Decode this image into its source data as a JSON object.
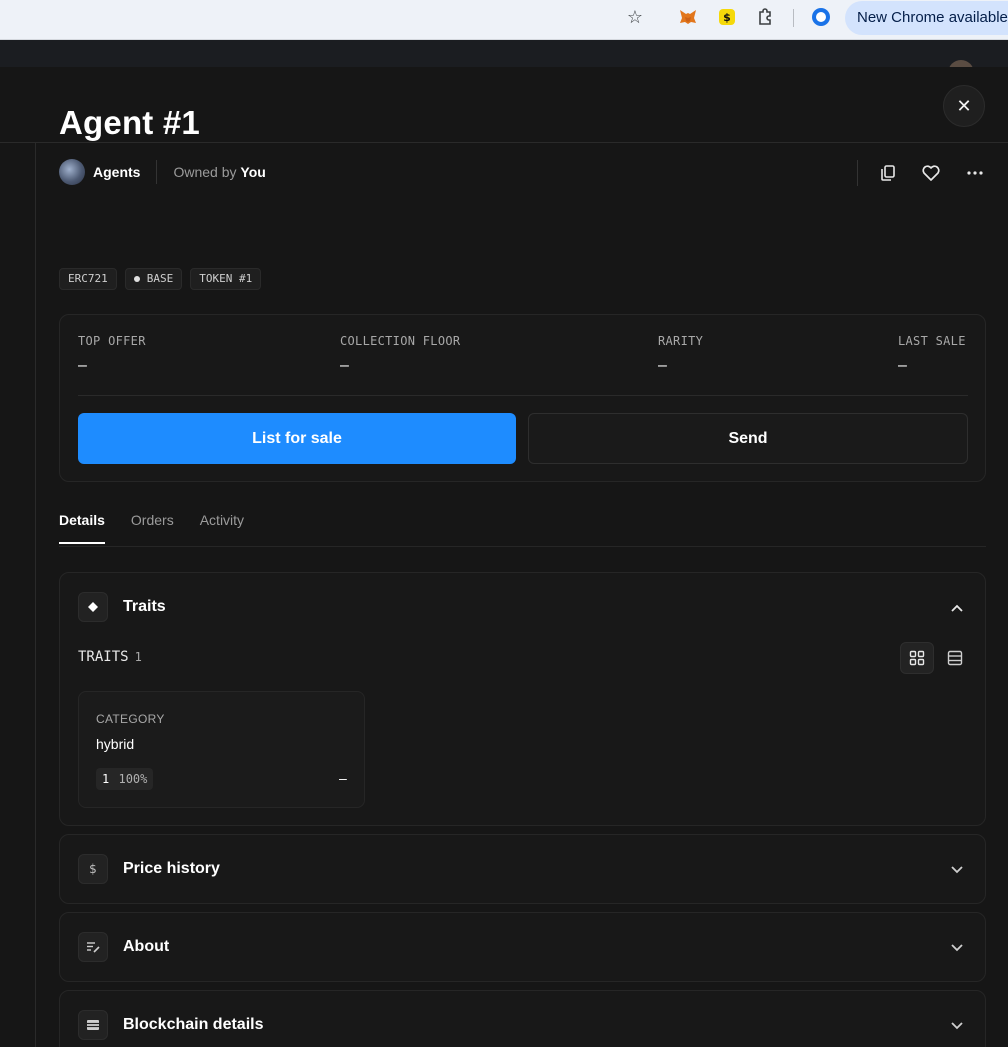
{
  "browser": {
    "update_chip": "New Chrome available",
    "icons": [
      "star-icon",
      "metamask-icon",
      "extension-icon",
      "puzzle-icon",
      "profile-icon"
    ]
  },
  "modal": {
    "close_symbol": "✕"
  },
  "item": {
    "title": "Agent #1",
    "collection": "Agents",
    "owned_prefix": "Owned by",
    "owner": "You",
    "badges": {
      "standard": "ERC721",
      "chain": "BASE",
      "token": "TOKEN #1"
    }
  },
  "stats": {
    "top_offer": {
      "label": "TOP OFFER",
      "value": "–"
    },
    "collection_floor": {
      "label": "COLLECTION FLOOR",
      "value": "–"
    },
    "rarity": {
      "label": "RARITY",
      "value": "–"
    },
    "last_sale": {
      "label": "LAST SALE",
      "value": "–"
    }
  },
  "buttons": {
    "list_for_sale": "List for sale",
    "send": "Send"
  },
  "tabs": [
    {
      "label": "Details",
      "active": true
    },
    {
      "label": "Orders",
      "active": false
    },
    {
      "label": "Activity",
      "active": false
    }
  ],
  "traits_panel": {
    "title": "Traits",
    "section_label": "TRAITS",
    "count": "1",
    "trait": {
      "type": "CATEGORY",
      "value": "hybrid",
      "count": "1",
      "percent": "100%",
      "price": "–"
    }
  },
  "panels": {
    "price_history": "Price history",
    "about": "About",
    "blockchain_details": "Blockchain details"
  },
  "colors": {
    "background": "#161616",
    "accent": "#1e8cff",
    "card": "#181818",
    "border": "#262626"
  }
}
